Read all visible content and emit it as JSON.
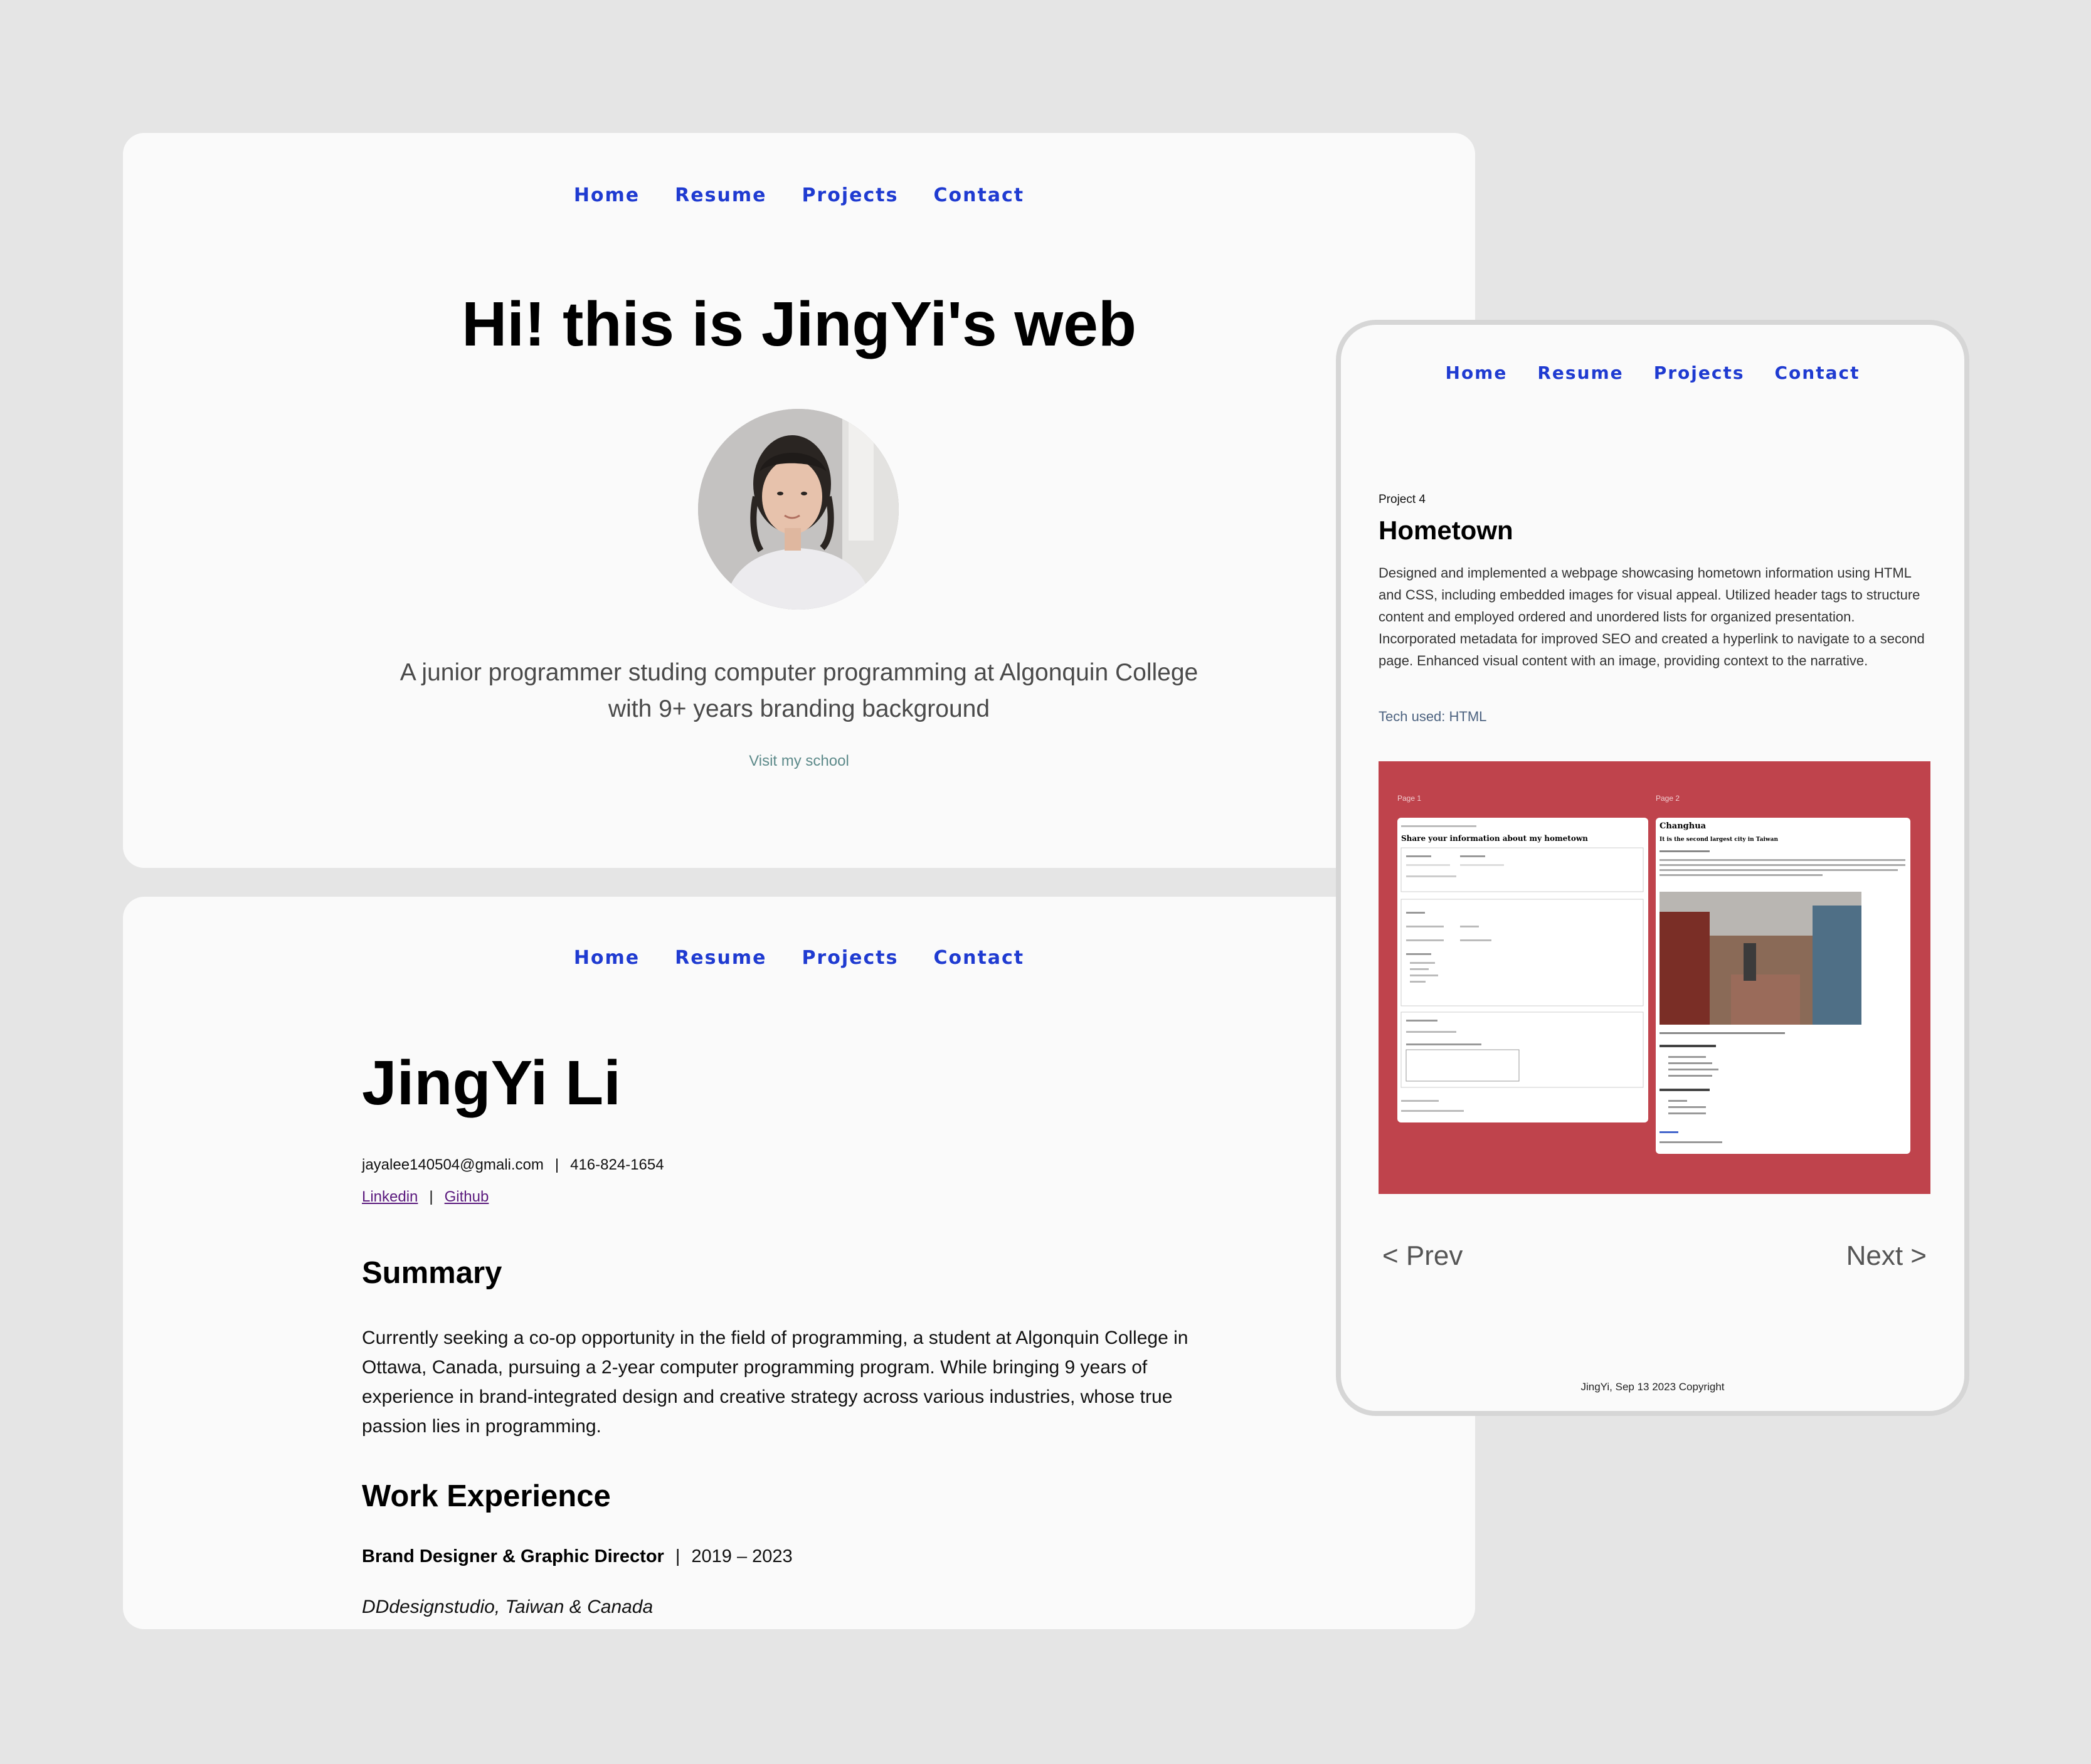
{
  "nav": {
    "items": [
      "Home",
      "Resume",
      "Projects",
      "Contact"
    ]
  },
  "home": {
    "title": "Hi! this is JingYi's web",
    "tagline_line1": "A junior programmer studing computer programming at Algonquin College",
    "tagline_line2": "with 9+ years branding background",
    "school_link": "Visit my school"
  },
  "resume": {
    "name": "JingYi Li",
    "email": "jayalee140504@gmali.com",
    "phone": "416-824-1654",
    "separator": "|",
    "linkedin": "Linkedin",
    "github": "Github",
    "summary_heading": "Summary",
    "summary": "Currently seeking a co-op opportunity in the field of programming, a student at Algonquin College in Ottawa, Canada, pursuing a 2-year computer programming program. While bringing 9 years of experience in brand-integrated design and creative strategy across various industries, whose true passion lies in programming.",
    "work_heading": "Work Experience",
    "job_title": "Brand Designer & Graphic Director",
    "job_years": "2019 – 2023",
    "company": "DDdesignstudio, Taiwan & Canada"
  },
  "project": {
    "label": "Project 4",
    "title": "Hometown",
    "description": "Designed and implemented a webpage showcasing hometown information using HTML and CSS, including embedded images for visual appeal. Utilized header tags to structure content and employed ordered and unordered lists for organized presentation. Incorporated metadata for improved SEO and created a hyperlink to navigate to a second page. Enhanced visual content with an image, providing context to the narrative.",
    "tech": "Tech used: HTML",
    "page1_label": "Page 1",
    "page2_label": "Page 2",
    "page1_heading": "Share your information about my hometown",
    "page2_heading": "Changhua",
    "page2_subheading": "It is the second largest city in Taiwan",
    "prev": "< Prev",
    "next": "Next >",
    "footer": "JingYi, Sep 13 2023 Copyright"
  },
  "colors": {
    "background": "#e5e5e5",
    "card": "#fafafa",
    "nav_link": "#1f3bd1",
    "project_screenshot_bg": "#bf434c"
  }
}
